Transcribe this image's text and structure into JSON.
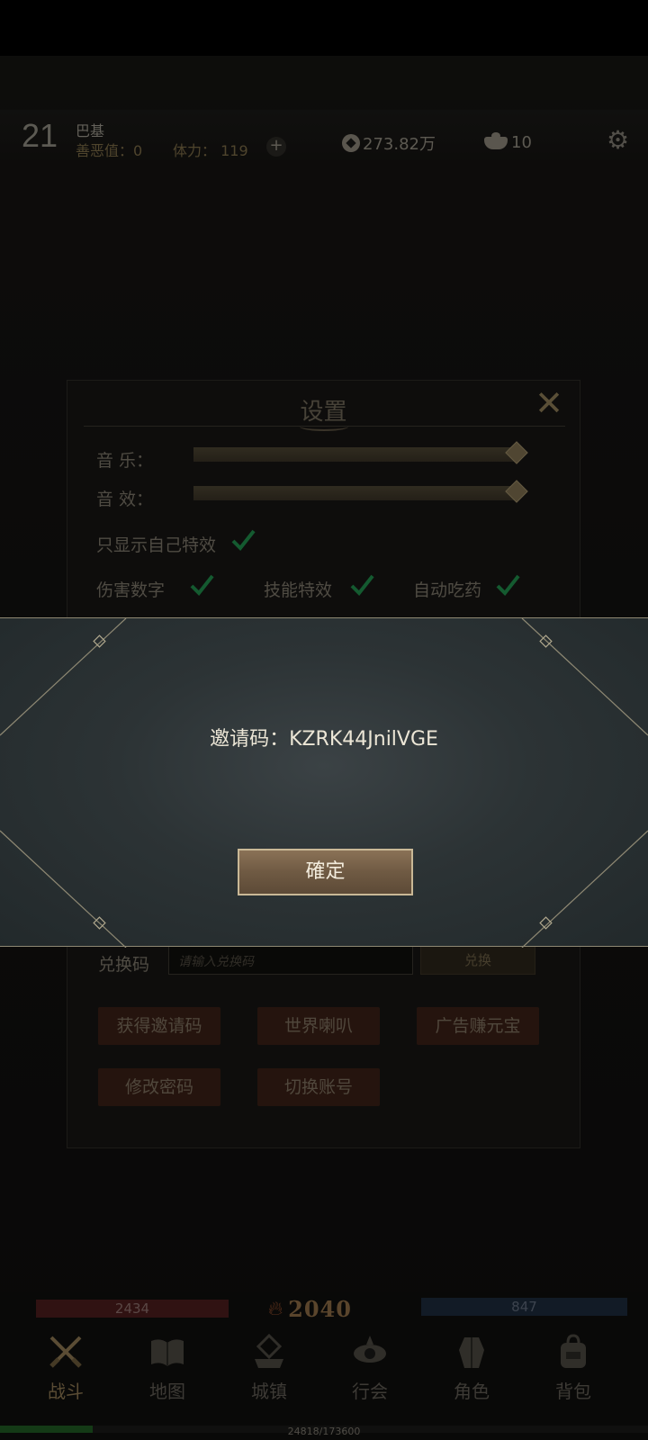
{
  "hud": {
    "level": "21",
    "player_name": "巴基",
    "karma": "善恶值：0",
    "stamina": "体力： 119",
    "plus": "+",
    "coins": "273.82万",
    "ingots": "10"
  },
  "settings": {
    "title": "设置",
    "music_label": "音 乐：",
    "music_level": 1.0,
    "sfx_label": "音 效：",
    "sfx_level": 1.0,
    "own_effects_label": "只显示自己特效",
    "damage_numbers_label": "伤害数字",
    "skill_effects_label": "技能特效",
    "auto_potion_label": "自动吃药",
    "own_effects_checked": true,
    "damage_numbers_checked": true,
    "skill_effects_checked": true,
    "auto_potion_checked": true,
    "redeem_label": "兑换码",
    "redeem_placeholder": "请输入兑换码",
    "redeem_button": "兑换",
    "buttons": [
      "获得邀请码",
      "世界喇叭",
      "广告赚元宝",
      "修改密码",
      "切换账号"
    ]
  },
  "modal": {
    "invite_text": "邀请码：KZRK44JnilVGE",
    "confirm": "確定"
  },
  "bottom": {
    "hp": "2434",
    "mp": "847",
    "power": "2040",
    "xp_text": "24818/173600",
    "xp_fraction": 0.143
  },
  "nav": [
    {
      "label": "战斗",
      "icon": "crossed-swords-icon"
    },
    {
      "label": "地图",
      "icon": "book-map-icon"
    },
    {
      "label": "城镇",
      "icon": "town-icon"
    },
    {
      "label": "行会",
      "icon": "guild-icon"
    },
    {
      "label": "角色",
      "icon": "character-icon"
    },
    {
      "label": "背包",
      "icon": "backpack-icon"
    }
  ],
  "colors": {
    "accent": "#c9b896",
    "check_green": "#1f8a4a",
    "hp_red": "#4a1c1c",
    "mp_blue": "#1d2a3b"
  }
}
